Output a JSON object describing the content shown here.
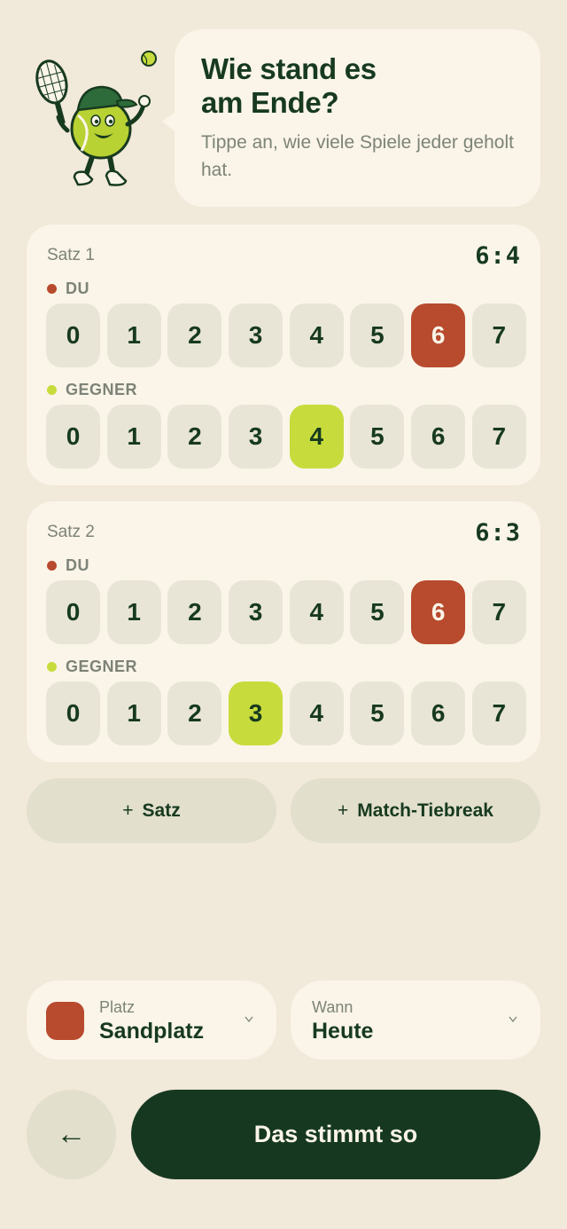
{
  "header": {
    "title": "Wie stand es\nam Ende?",
    "subtitle": "Tippe an, wie viele Spiele jeder geholt hat."
  },
  "player_labels": {
    "du": "DU",
    "gegner": "GEGNER"
  },
  "game_options": [
    "0",
    "1",
    "2",
    "3",
    "4",
    "5",
    "6",
    "7"
  ],
  "sets": [
    {
      "title": "Satz 1",
      "score": "6:4",
      "du": 6,
      "gegner": 4
    },
    {
      "title": "Satz 2",
      "score": "6:3",
      "du": 6,
      "gegner": 3
    }
  ],
  "add_buttons": {
    "plus": "+",
    "satz": "Satz",
    "tiebreak": "Match-Tiebreak"
  },
  "selectors": {
    "platz": {
      "label": "Platz",
      "value": "Sandplatz"
    },
    "wann": {
      "label": "Wann",
      "value": "Heute"
    },
    "chevron": "v"
  },
  "footer": {
    "back": "←",
    "confirm": "Das stimmt so"
  },
  "colors": {
    "background": "#f1e9da",
    "card": "#faf5e8",
    "du_accent": "#b84a2e",
    "gegner_accent": "#c7dc3c",
    "primary": "#163820",
    "muted": "#7d8378"
  },
  "icons": {
    "mascot": "tennis-ball-mascot-icon",
    "back": "arrow-left-icon",
    "chevron": "chevron-down-icon"
  }
}
